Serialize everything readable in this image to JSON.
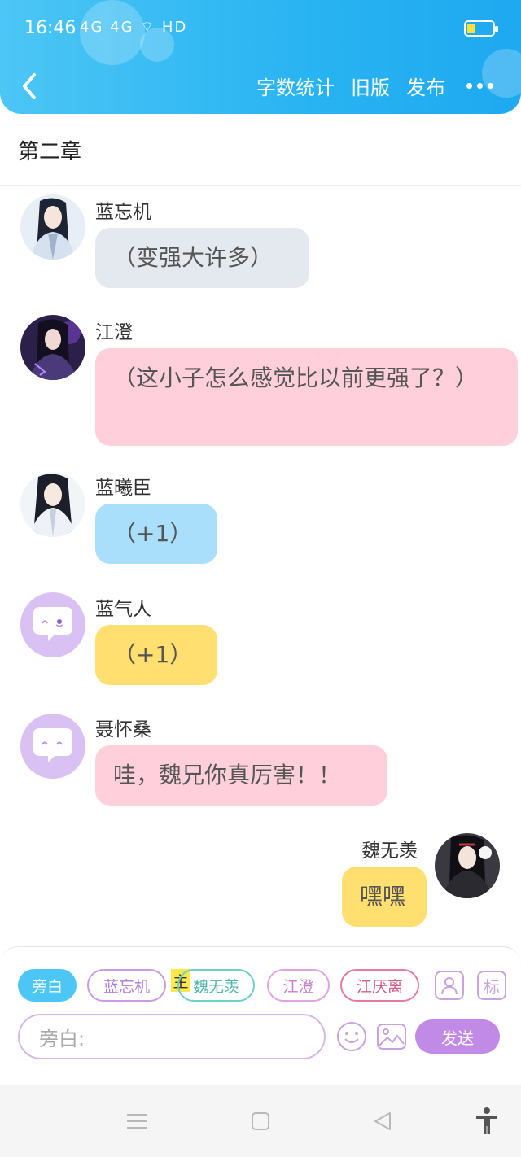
{
  "status_bar": {
    "time": "16:46",
    "signal": "4G 4G",
    "network": "HD"
  },
  "header": {
    "word_count": "字数统计",
    "old_version": "旧版",
    "publish": "发布"
  },
  "chapter": {
    "title": "第二章"
  },
  "messages": [
    {
      "sender": "蓝忘机",
      "text": "（变强大许多）"
    },
    {
      "sender": "江澄",
      "text": "（这小子怎么感觉比以前更强了？）"
    },
    {
      "sender": "蓝曦臣",
      "text": "（+1）"
    },
    {
      "sender": "蓝气人",
      "text": "（+1）"
    },
    {
      "sender": "聂怀桑",
      "text": "哇，魏兄你真厉害！！"
    },
    {
      "sender": "魏无羡",
      "text": "嘿嘿"
    }
  ],
  "composer": {
    "chips": [
      "旁白",
      "蓝忘机",
      "魏无羡",
      "江澄",
      "江厌离"
    ],
    "main_badge": "主",
    "tag_icon": "标",
    "placeholder": "旁白:",
    "send": "发送"
  },
  "colors": {
    "header": "#28b3f2",
    "bubble_gray": "#e4e8ef",
    "bubble_pink": "#ffd0dc",
    "bubble_blue": "#a9dffa",
    "bubble_yellow": "#ffdf70",
    "accent_purple": "#c08ae6"
  }
}
